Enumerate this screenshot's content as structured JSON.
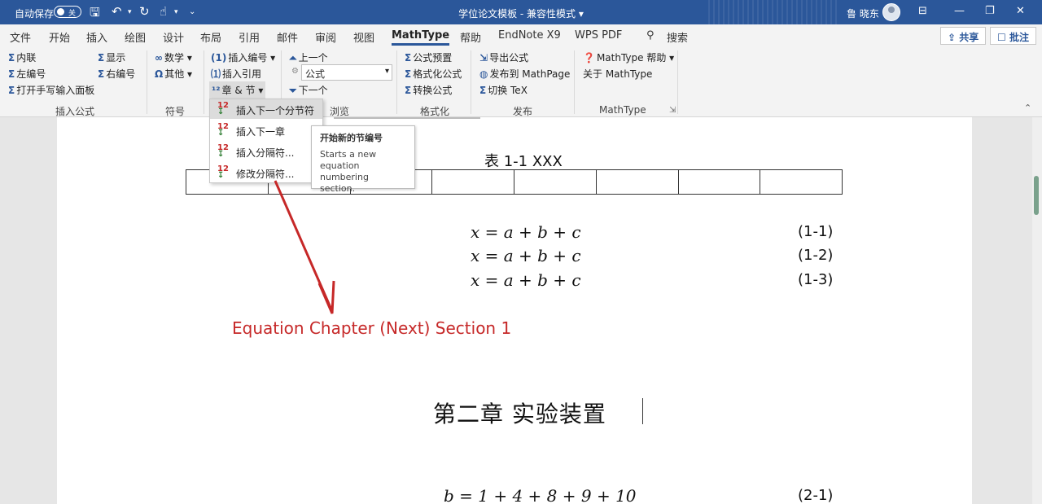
{
  "titlebar": {
    "autosave_label": "自动保存",
    "autosave_state": "关",
    "doc_title": "学位论文模板 - 兼容性模式 ▾",
    "user": "鲁 晓东"
  },
  "menu": {
    "tabs": [
      "文件",
      "开始",
      "插入",
      "绘图",
      "设计",
      "布局",
      "引用",
      "邮件",
      "审阅",
      "视图",
      "MathType",
      "帮助",
      "EndNote X9",
      "WPS PDF"
    ],
    "search": "搜索",
    "share": "共享",
    "comment": "批注"
  },
  "ribbon": {
    "inline": "内联",
    "left_number": "左编号",
    "open_handwriting": "打开手写输入面板",
    "display": "显示",
    "right_number": "右编号",
    "group_insert": "插入公式",
    "math": "数学",
    "other": "其他",
    "group_symbols": "符号",
    "insert_number": "插入编号",
    "insert_ref": "插入引用",
    "chapter_section": "章 & 节",
    "prev": "上一个",
    "combo_value": "公式",
    "next": "下一个",
    "group_browse": "浏览",
    "format_preset": "公式预置",
    "format_eq": "格式化公式",
    "convert_eq": "转换公式",
    "group_format": "格式化",
    "export_eq": "导出公式",
    "publish_mathpage": "发布到 MathPage",
    "toggle_tex": "切换 TeX",
    "group_publish": "发布",
    "mathtype_help": "MathType 帮助",
    "about_mathtype": "关于 MathType",
    "group_mathtype": "MathType"
  },
  "dropdown": {
    "items": [
      "插入下一个分节符",
      "插入下一章",
      "插入分隔符...",
      "修改分隔符..."
    ]
  },
  "tooltip": {
    "title": "开始新的节编号",
    "description": "Starts a new equation numbering section."
  },
  "document": {
    "table_caption": "表 1-1   XXX",
    "equations": [
      {
        "expr": "x = a + b + c",
        "num": "(1-1)"
      },
      {
        "expr": "x = a + b + c",
        "num": "(1-2)"
      },
      {
        "expr": "x = a + b + c",
        "num": "(1-3)"
      }
    ],
    "annotation": "Equation Chapter (Next) Section 1",
    "chapter_title": "第二章    实验装置",
    "eq2": {
      "expr": "b = 1 + 4 + 8 + 9 + 10",
      "num": "(2-1)"
    }
  },
  "colors": {
    "accent": "#2b579a",
    "annotation": "#c62828"
  }
}
